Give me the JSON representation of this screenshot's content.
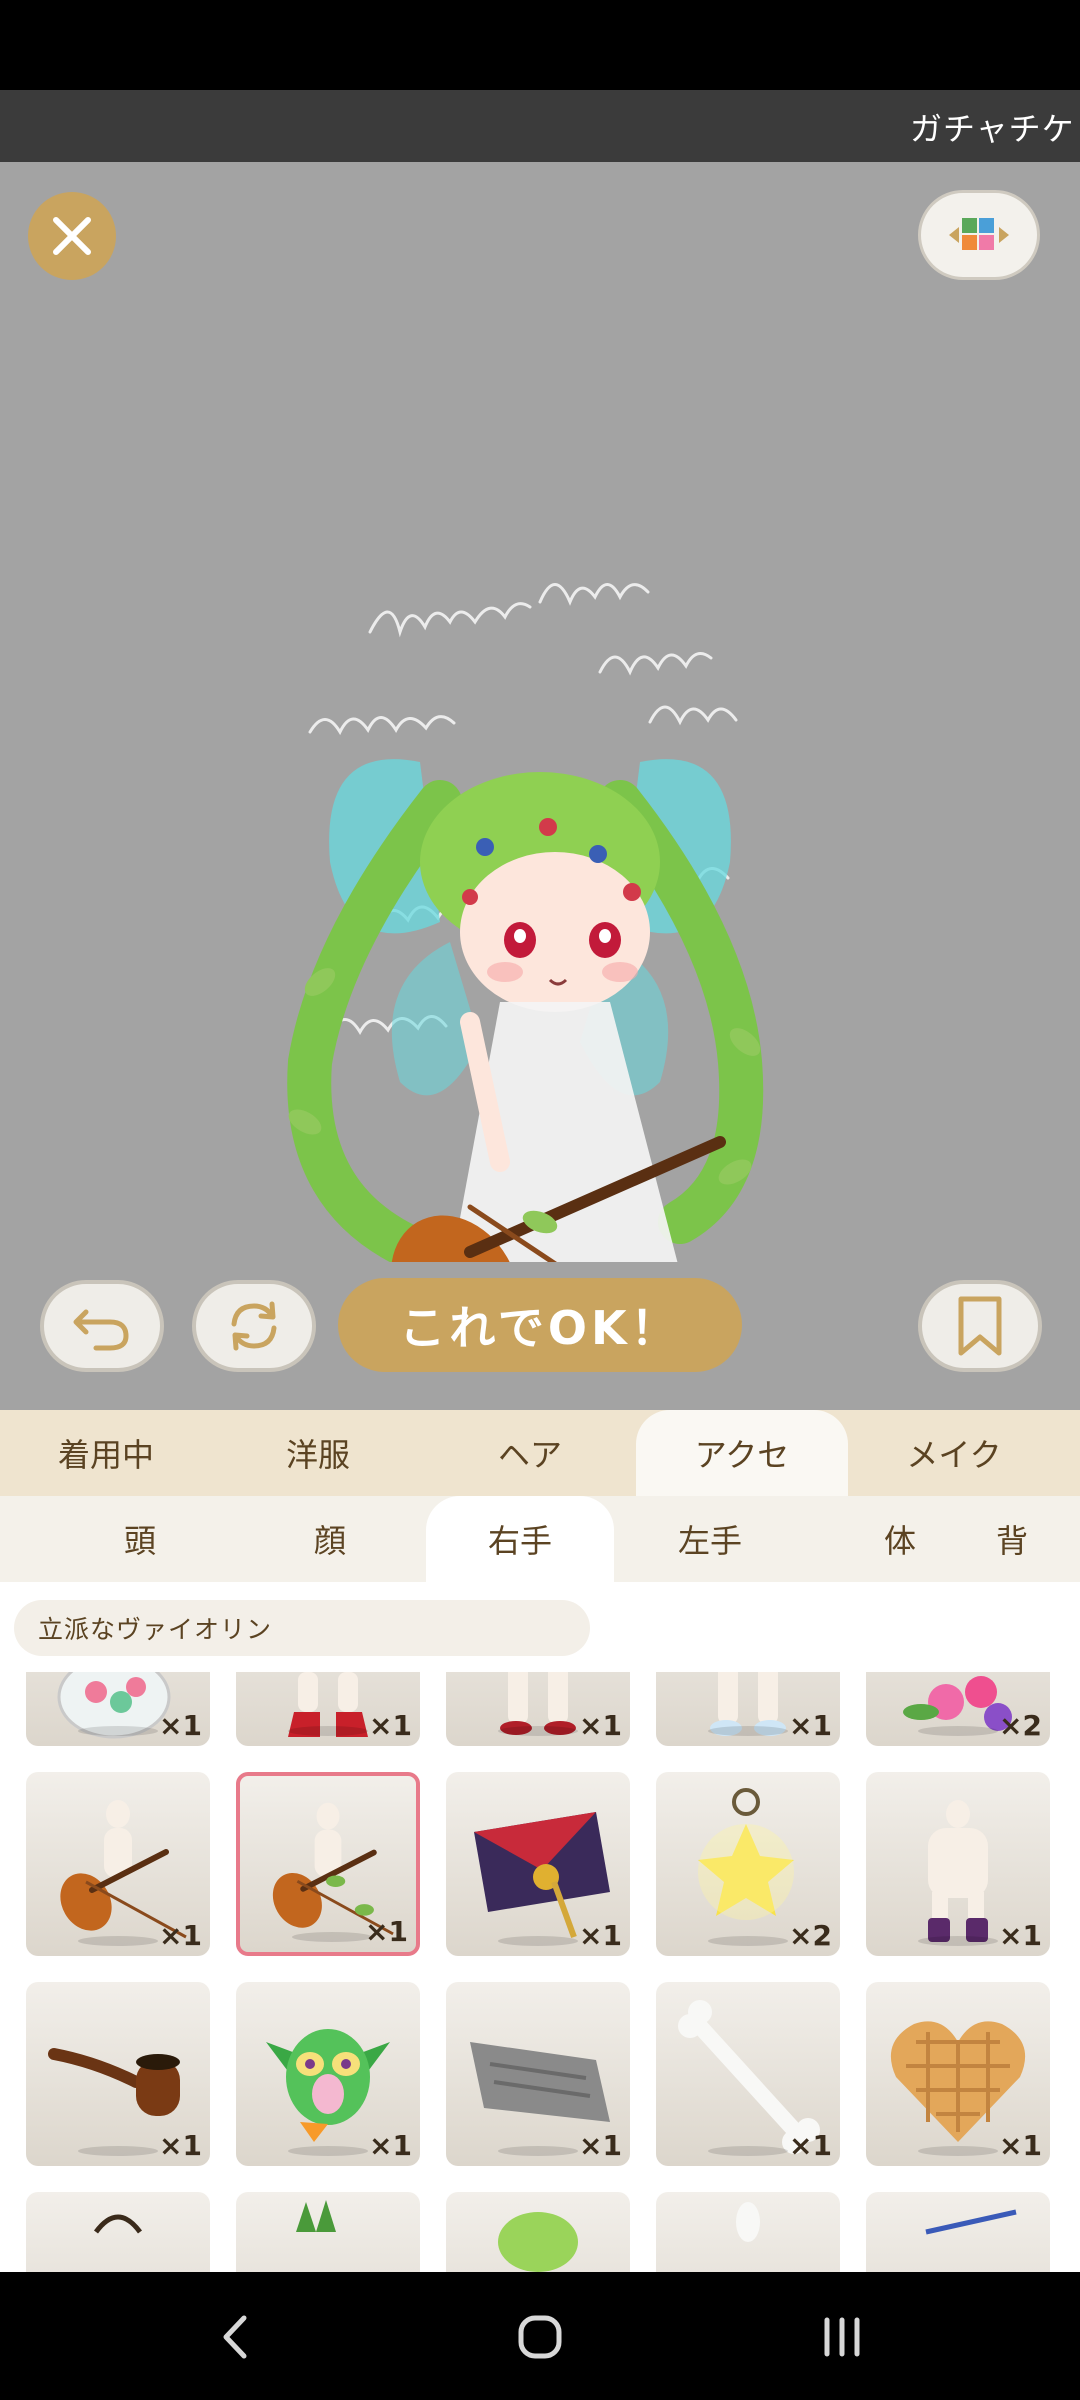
{
  "ticker": {
    "text": "ガチャチケ"
  },
  "preview": {
    "ok_button_label": "これでOK！"
  },
  "category_tabs": [
    {
      "label": "着用中"
    },
    {
      "label": "洋服"
    },
    {
      "label": "ヘア"
    },
    {
      "label": "アクセ",
      "active": true
    },
    {
      "label": "メイク"
    }
  ],
  "sub_tabs": [
    {
      "label": "頭"
    },
    {
      "label": "顔"
    },
    {
      "label": "右手",
      "active": true
    },
    {
      "label": "左手"
    },
    {
      "label": "体"
    },
    {
      "label": "背"
    }
  ],
  "selected_item_name": "立派なヴァイオリン",
  "items": [
    {
      "icon": "candy-jar-icon",
      "qty": "×1"
    },
    {
      "icon": "red-boots-icon",
      "qty": "×1"
    },
    {
      "icon": "red-shoes-icon",
      "qty": "×1"
    },
    {
      "icon": "white-socks-icon",
      "qty": "×1"
    },
    {
      "icon": "flower-bouquet-icon",
      "qty": "×2"
    },
    {
      "icon": "violin-icon",
      "qty": "×1"
    },
    {
      "icon": "vine-violin-icon",
      "qty": "×1",
      "selected": true
    },
    {
      "icon": "envelope-key-icon",
      "qty": "×1"
    },
    {
      "icon": "star-keychain-icon",
      "qty": "×2"
    },
    {
      "icon": "purple-boots-icon",
      "qty": "×1"
    },
    {
      "icon": "pipe-icon",
      "qty": "×1"
    },
    {
      "icon": "green-creature-icon",
      "qty": "×1"
    },
    {
      "icon": "stone-tablet-icon",
      "qty": "×1"
    },
    {
      "icon": "bone-icon",
      "qty": "×1"
    },
    {
      "icon": "heart-waffle-icon",
      "qty": "×1"
    }
  ],
  "colors": {
    "accent_gold": "#c9a45f",
    "tab_bar": "#efe4cf",
    "stage_gray": "#a3a3a3",
    "selected_border": "#e87a8a"
  }
}
